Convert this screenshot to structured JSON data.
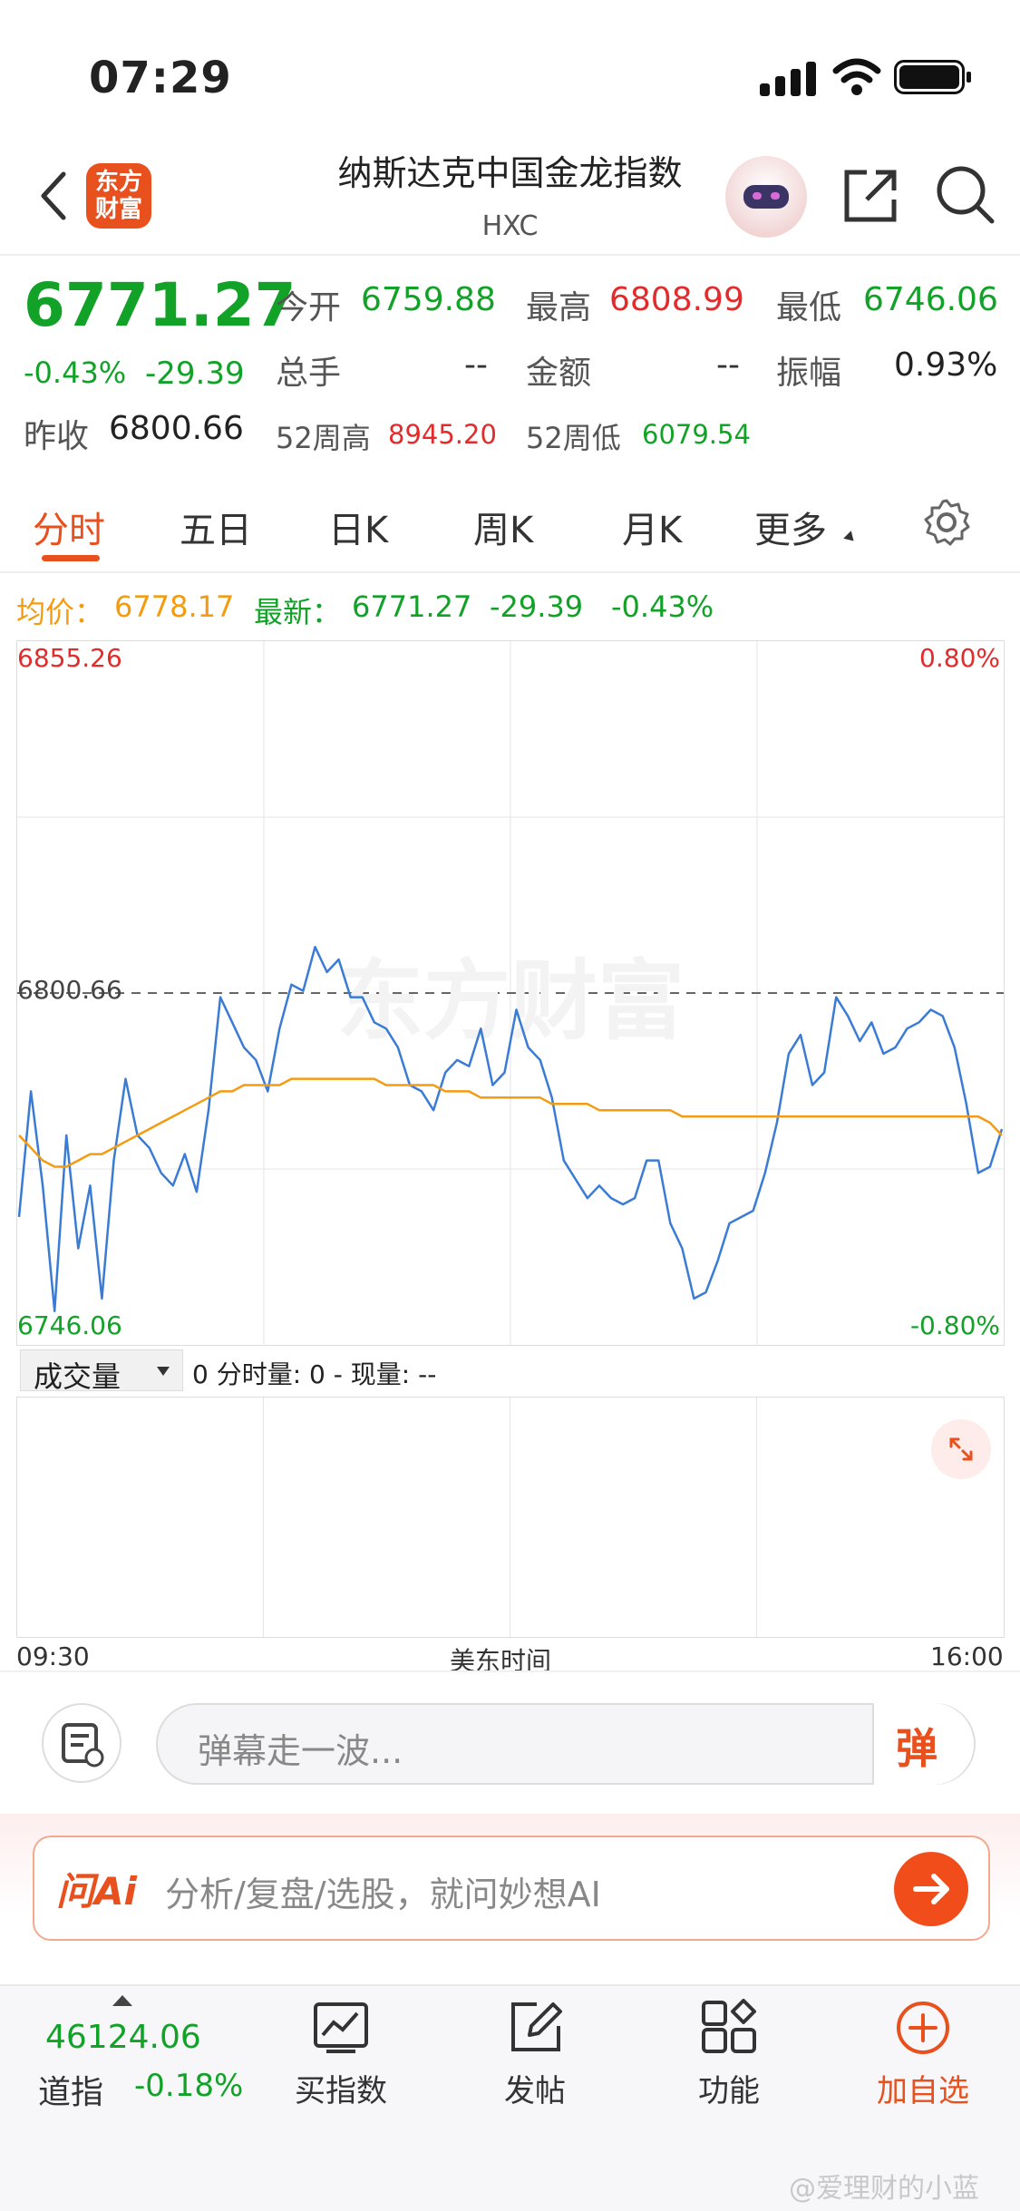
{
  "status": {
    "time": "07:29"
  },
  "header": {
    "logo_text_1": "东方",
    "logo_text_2": "财富",
    "title": "纳斯达克中国金龙指数",
    "code": "HXC"
  },
  "quote": {
    "price": "6771.27",
    "change_pct": "-0.43%",
    "change": "-29.39",
    "open_label": "今开",
    "open": "6759.88",
    "high_label": "最高",
    "high": "6808.99",
    "low_label": "最低",
    "low": "6746.06",
    "volume_label": "总手",
    "volume": "--",
    "amount_label": "金额",
    "amount": "--",
    "amplitude_label": "振幅",
    "amplitude": "0.93%",
    "prev_close_label": "昨收",
    "prev_close": "6800.66",
    "w52_high_label": "52周高",
    "w52_high": "8945.20",
    "w52_low_label": "52周低",
    "w52_low": "6079.54"
  },
  "tabs": [
    "分时",
    "五日",
    "日K",
    "周K",
    "月K",
    "更多"
  ],
  "chart_info": {
    "avg_label": "均价：",
    "avg": "6778.17",
    "latest_label": "最新：",
    "latest": "6771.27",
    "latest_change": "-29.39",
    "latest_pct": "-0.43%"
  },
  "chart_data": {
    "type": "line",
    "title": "",
    "x_start_label": "09:30",
    "x_end_label": "16:00",
    "x_center_label": "美东时间",
    "y_max_label": "6855.26",
    "y_min_label": "6746.06",
    "y_ref_label": "6800.66",
    "pct_max_label": "0.80%",
    "pct_min_label": "-0.80%",
    "watermark": "东方财富",
    "ylim": [
      6746.06,
      6855.26
    ],
    "prev_close": 6800.66,
    "series": [
      {
        "color": "#3a7bd5",
        "values": [
          6765,
          6785,
          6770,
          6750,
          6778,
          6760,
          6770,
          6752,
          6774,
          6787,
          6778,
          6776,
          6772,
          6770,
          6775,
          6769,
          6782,
          6800,
          6796,
          6792,
          6790,
          6785,
          6795,
          6802,
          6801,
          6808,
          6804,
          6806,
          6800,
          6800,
          6796,
          6795,
          6792,
          6786,
          6785,
          6782,
          6788,
          6790,
          6789,
          6795,
          6786,
          6788,
          6798,
          6792,
          6790,
          6784,
          6774,
          6771,
          6768,
          6770,
          6768,
          6767,
          6768,
          6774,
          6774,
          6764,
          6760,
          6752,
          6753,
          6758,
          6764,
          6765,
          6766,
          6772,
          6780,
          6791,
          6794,
          6786,
          6788,
          6800,
          6797,
          6793,
          6796,
          6791,
          6792,
          6795,
          6796,
          6798,
          6797,
          6792,
          6783,
          6772,
          6773,
          6779
        ]
      },
      {
        "color": "#f39c12",
        "values": [
          6778,
          6776,
          6774,
          6773,
          6773,
          6774,
          6775,
          6775,
          6776,
          6777,
          6778,
          6779,
          6780,
          6781,
          6782,
          6783,
          6784,
          6785,
          6785,
          6786,
          6786,
          6786,
          6786,
          6787,
          6787,
          6787,
          6787,
          6787,
          6787,
          6787,
          6787,
          6786,
          6786,
          6786,
          6786,
          6786,
          6785,
          6785,
          6785,
          6784,
          6784,
          6784,
          6784,
          6784,
          6784,
          6783,
          6783,
          6783,
          6783,
          6782,
          6782,
          6782,
          6782,
          6782,
          6782,
          6782,
          6781,
          6781,
          6781,
          6781,
          6781,
          6781,
          6781,
          6781,
          6781,
          6781,
          6781,
          6781,
          6781,
          6781,
          6781,
          6781,
          6781,
          6781,
          6781,
          6781,
          6781,
          6781,
          6781,
          6781,
          6781,
          6781,
          6780,
          6778
        ]
      }
    ]
  },
  "volume_panel": {
    "selector": "成交量",
    "values_text": "0 分时量: 0 - 现量: --"
  },
  "danmu": {
    "placeholder": "弹幕走一波...",
    "send_label": "弹"
  },
  "ai": {
    "logo": "问Ai",
    "placeholder": "分析/复盘/选股，就问妙想AI"
  },
  "bottom": {
    "index_value": "46124.06",
    "index_name": "道指",
    "index_change": "-0.18%",
    "buy_label": "买指数",
    "post_label": "发帖",
    "func_label": "功能",
    "watch_label": "加自选"
  },
  "watermark_user": "@爱理财的小蓝"
}
